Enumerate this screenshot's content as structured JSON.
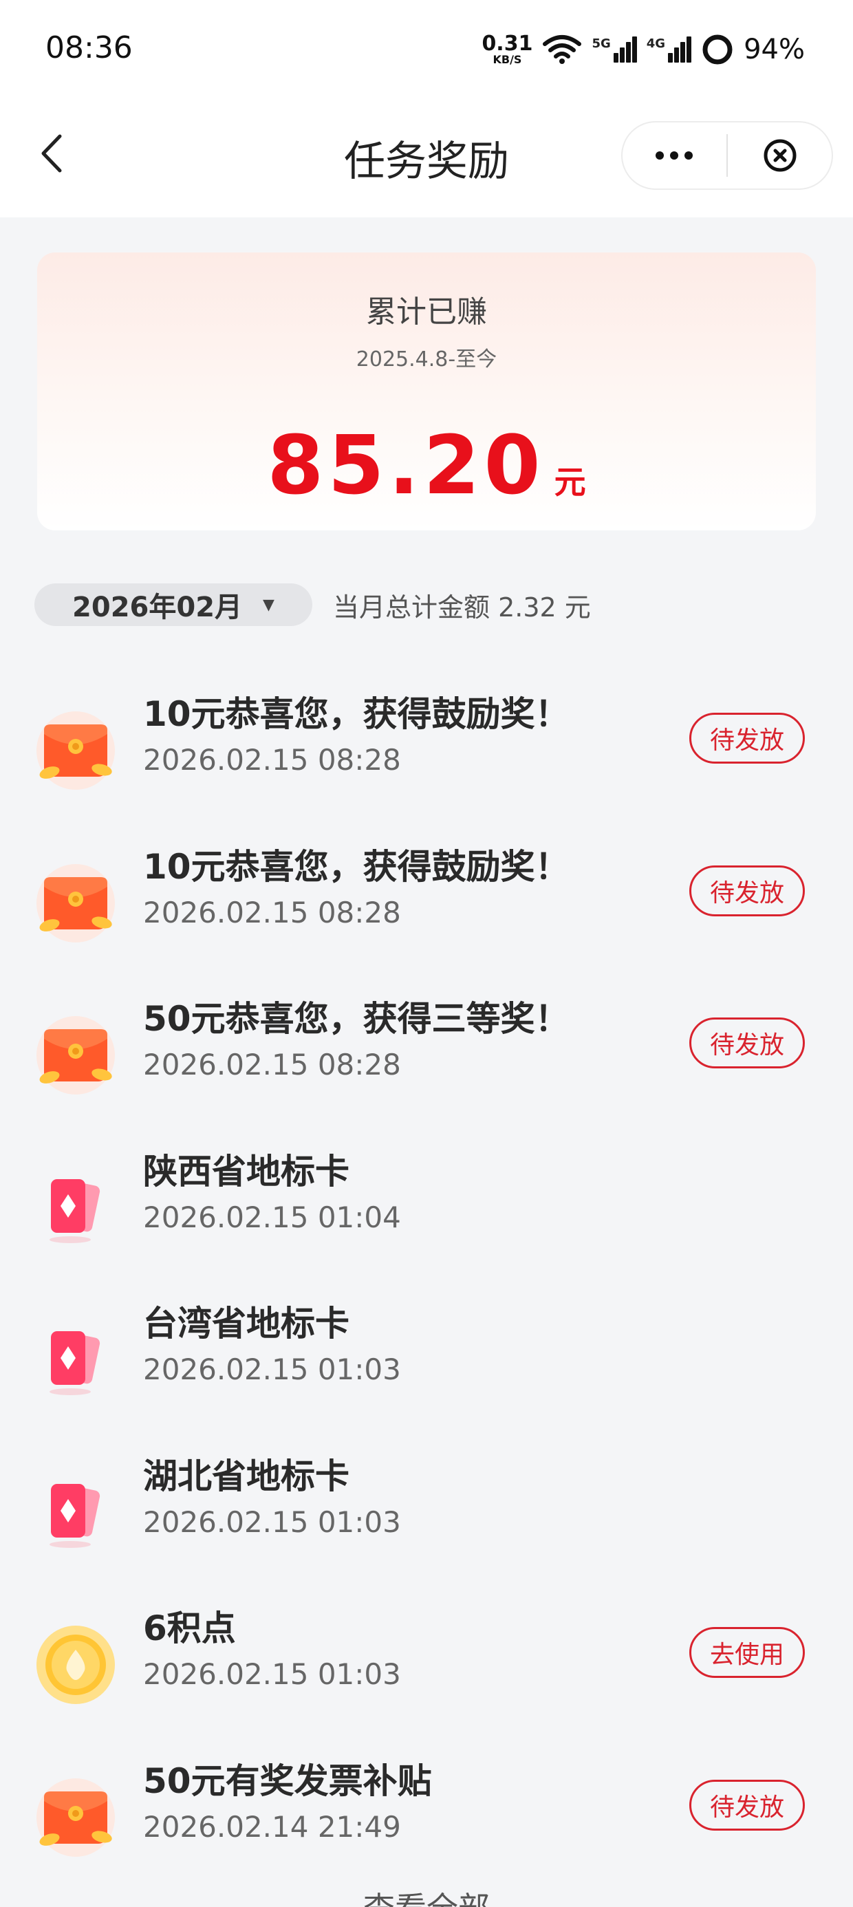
{
  "status_bar": {
    "time": "08:36",
    "net_speed_value": "0.31",
    "net_speed_unit": "KB/S",
    "sig1_label": "5G",
    "sig2_label": "4G",
    "battery": "94%"
  },
  "header": {
    "title": "任务奖励",
    "icons": [
      "back-chevron",
      "more-dots",
      "close-circle"
    ]
  },
  "summary": {
    "label": "累计已赚",
    "range": "2025.4.8-至今",
    "amount": "85.20",
    "unit": "元"
  },
  "filter": {
    "month": "2026年02月",
    "caret": "▼",
    "total": "当月总计金额 2.32 元"
  },
  "rewards": [
    {
      "title": "10元恭喜您，获得鼓励奖！",
      "time": "2026.02.15 08:28",
      "icon": "red-envelope",
      "badge": "待发放"
    },
    {
      "title": "10元恭喜您，获得鼓励奖！",
      "time": "2026.02.15 08:28",
      "icon": "red-envelope",
      "badge": "待发放"
    },
    {
      "title": "50元恭喜您，获得三等奖！",
      "time": "2026.02.15 08:28",
      "icon": "red-envelope",
      "badge": "待发放"
    },
    {
      "title": "陕西省地标卡",
      "time": "2026.02.15 01:04",
      "icon": "landmark-card",
      "badge": ""
    },
    {
      "title": "台湾省地标卡",
      "time": "2026.02.15 01:03",
      "icon": "landmark-card",
      "badge": ""
    },
    {
      "title": "湖北省地标卡",
      "time": "2026.02.15 01:03",
      "icon": "landmark-card",
      "badge": ""
    },
    {
      "title": "6积点",
      "time": "2026.02.15 01:03",
      "icon": "points-coin",
      "badge": "去使用"
    },
    {
      "title": "50元有奖发票补贴",
      "time": "2026.02.14 21:49",
      "icon": "red-envelope",
      "badge": "待发放"
    }
  ],
  "footer": {
    "view_all": "查看全部"
  },
  "colors": {
    "accent_red": "#e8101b",
    "badge_red": "#d9232e",
    "page_bg": "#f4f5f7"
  }
}
